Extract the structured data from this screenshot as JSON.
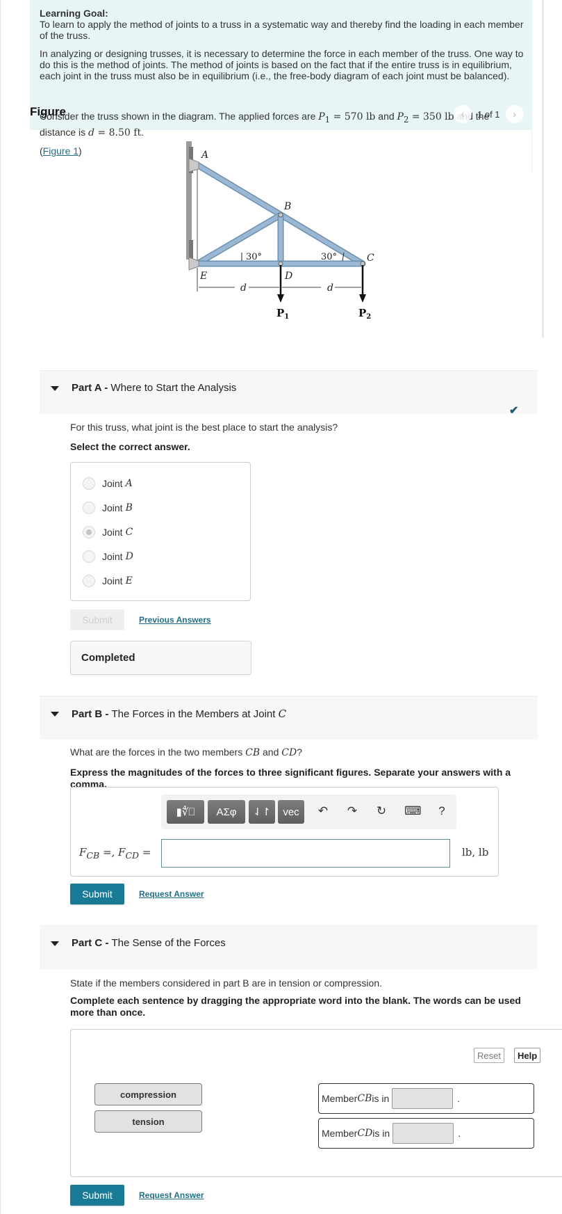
{
  "intro": {
    "learning_goal_title": "Learning Goal:",
    "learning_goal_text": "To learn to apply the method of joints to a truss in a systematic way and thereby find the loading in each member of the truss.",
    "paragraph": "In analyzing or designing trusses, it is necessary to determine the force in each member of the truss. One way to do this is the method of joints. The method of joints is based on the fact that if the entire truss is in equilibrium, each joint in the truss must also be in equilibrium (i.e., the free-body diagram of each joint must be balanced).",
    "consider_prefix": "Consider the truss shown in the diagram. The applied forces are ",
    "p1_label": "P",
    "p1_sub": "1",
    "p1_value": " = 570 lb",
    "and": " and ",
    "p2_label": "P",
    "p2_sub": "2",
    "p2_value": " = 350 lb",
    "consider_mid": " and the distance is ",
    "d_label": "d",
    "d_value": " = 8.50 ft",
    "period": "."
  },
  "figure": {
    "label": "Figure",
    "pager_text": "1 of 1",
    "prev_icon": "chevron-left-icon",
    "next_icon": "chevron-right-icon",
    "link_open": "(",
    "link_text": "Figure 1",
    "link_close": ")",
    "diagram": {
      "joints": [
        "A",
        "B",
        "C",
        "D",
        "E"
      ],
      "angle_left": "30°",
      "angle_right": "30°",
      "dim_label": "d",
      "load_1": "P",
      "load_1_sub": "1",
      "load_2": "P",
      "load_2_sub": "2",
      "member_color": "#9ab8d3"
    }
  },
  "part_a": {
    "part": "Part A - ",
    "title": "Where to Start the Analysis",
    "status_icon": "checkmark-icon",
    "question": "For this truss, what joint is the best place to start the analysis?",
    "instruction": "Select the correct answer.",
    "options": [
      {
        "label": "Joint ",
        "var": "A",
        "selected": false
      },
      {
        "label": "Joint ",
        "var": "B",
        "selected": false
      },
      {
        "label": "Joint ",
        "var": "C",
        "selected": true
      },
      {
        "label": "Joint ",
        "var": "D",
        "selected": false
      },
      {
        "label": "Joint ",
        "var": "E",
        "selected": false
      }
    ],
    "submit_label": "Submit",
    "previous_answers_label": "Previous Answers",
    "completed_label": "Completed"
  },
  "part_b": {
    "part": "Part B - ",
    "title": "The Forces in the Members at Joint ",
    "title_var": "C",
    "question_prefix": "What are the forces in the two members ",
    "member1": "CB",
    "question_and": " and ",
    "member2": "CD",
    "question_suffix": "?",
    "instruction": "Express the magnitudes of the forces to three significant figures. Separate your answers with a comma.",
    "toolbar": {
      "template_btn": "▮∜⎕",
      "greek_btn": "ΑΣφ",
      "arrows_btn": "⇃↾",
      "vec_btn": "vec",
      "undo_icon": "↶",
      "redo_icon": "↷",
      "reset_icon": "↻",
      "keyboard_icon": "⌨",
      "help_icon": "?"
    },
    "field_label": "F_CB =, F_CD =",
    "input_value": "",
    "units": "lb, lb",
    "submit_label": "Submit",
    "request_answer_label": "Request Answer"
  },
  "part_c": {
    "part": "Part C - ",
    "title": "The Sense of the Forces",
    "question": "State if the members considered in part B are in tension or compression.",
    "instruction": "Complete each sentence by dragging the appropriate word into the blank. The words can be used more than once.",
    "reset_label": "Reset",
    "help_label": "Help",
    "words": [
      "compression",
      "tension"
    ],
    "sentences": [
      {
        "prefix": "Member ",
        "var": "CB",
        "suffix": " is in",
        "end": "."
      },
      {
        "prefix": "Member ",
        "var": "CD",
        "suffix": " is in",
        "end": "."
      }
    ],
    "submit_label": "Submit",
    "request_answer_label": "Request Answer"
  },
  "colors": {
    "accent": "#197a96",
    "link": "#1f6f87",
    "intro_bg": "#e8f5f6",
    "check": "#1e5a70"
  }
}
